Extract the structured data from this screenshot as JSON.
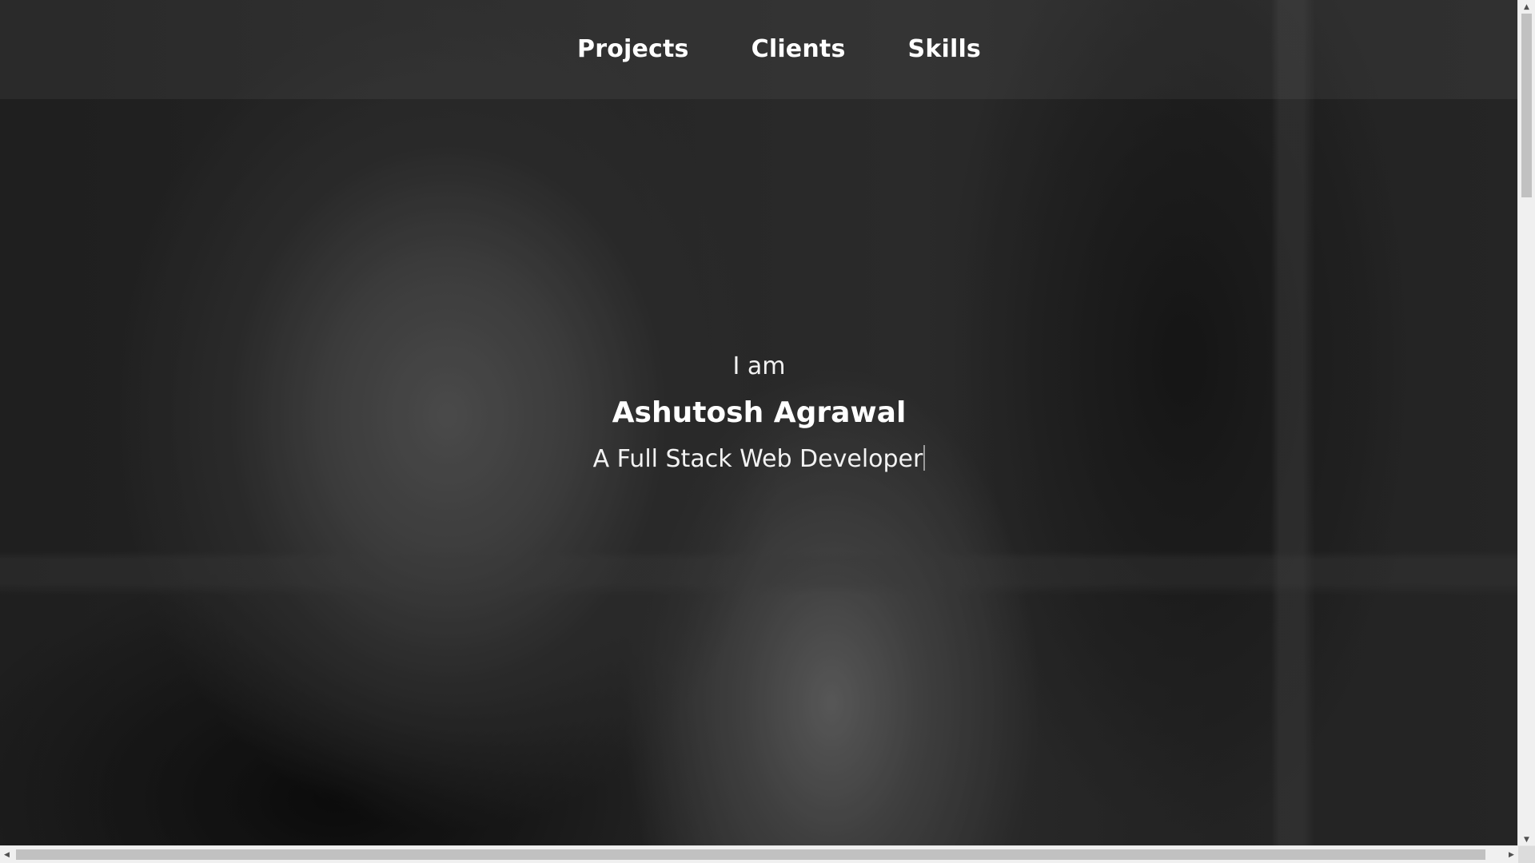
{
  "nav": {
    "items": [
      {
        "label": "Projects"
      },
      {
        "label": "Clients"
      },
      {
        "label": "Skills"
      }
    ]
  },
  "hero": {
    "intro": "I am",
    "name": "Ashutosh Agrawal",
    "role": "A Full Stack Web Developer"
  },
  "icons": {
    "scroll_up": "triangle-up",
    "scroll_down": "triangle-down",
    "scroll_left": "triangle-left",
    "scroll_right": "triangle-right"
  },
  "colors": {
    "text": "#ffffff",
    "background": "#2a2a2a",
    "scrollbar_track": "#f0f0f0",
    "scrollbar_thumb": "#c1c1c1"
  }
}
